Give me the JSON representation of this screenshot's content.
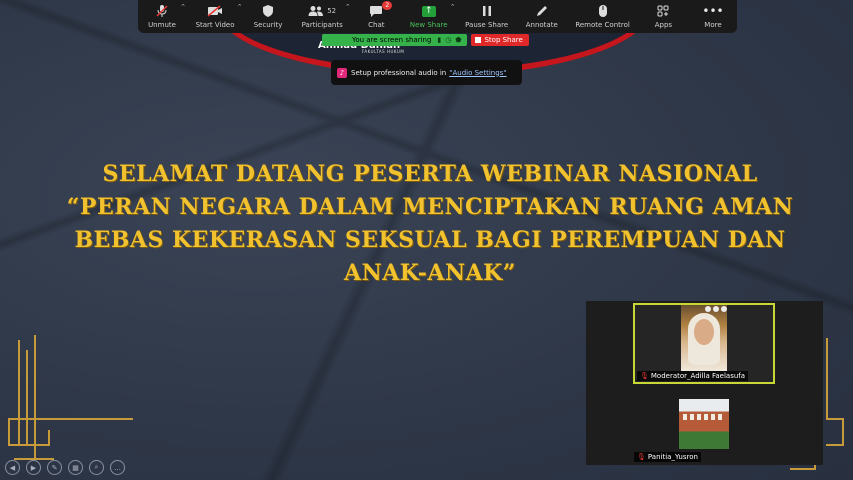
{
  "toolbar": {
    "items": [
      {
        "label": "Unmute",
        "icon": "mic-muted-icon"
      },
      {
        "label": "Start Video",
        "icon": "video-off-icon"
      },
      {
        "label": "Security",
        "icon": "shield-icon"
      },
      {
        "label": "Participants",
        "icon": "participants-icon",
        "count": "52"
      },
      {
        "label": "Chat",
        "icon": "chat-icon",
        "badge": "2"
      },
      {
        "label": "New Share",
        "icon": "share-arrow-icon"
      },
      {
        "label": "Pause Share",
        "icon": "pause-icon"
      },
      {
        "label": "Annotate",
        "icon": "pencil-icon"
      },
      {
        "label": "Remote Control",
        "icon": "mouse-icon"
      },
      {
        "label": "Apps",
        "icon": "apps-icon"
      },
      {
        "label": "More",
        "icon": "more-icon"
      }
    ]
  },
  "share_bar": {
    "status": "You are screen sharing",
    "stop_label": "Stop Share"
  },
  "banner": {
    "name": "Ahmad Dahlan",
    "sub": "FAKULTAS HUKUM"
  },
  "audio_tip": {
    "text": "Setup professional audio in",
    "link": "\"Audio Settings\""
  },
  "slide": {
    "lines": [
      "SELAMAT DATANG PESERTA WEBINAR NASIONAL",
      "“PERAN NEGARA DALAM MENCIPTAKAN RUANG AMAN",
      "BEBAS KEKERASAN SEKSUAL BAGI PEREMPUAN DAN",
      "ANAK-ANAK”"
    ]
  },
  "participants": [
    {
      "name": "Moderator_Adilla Faelasufa",
      "muted": true
    },
    {
      "name": "Panitia_Yusron",
      "muted": true
    }
  ],
  "colors": {
    "accent_green": "#35b24a",
    "stop_red": "#e02828",
    "title_gold": "#f2c12e",
    "active_speaker": "#c9d736"
  }
}
